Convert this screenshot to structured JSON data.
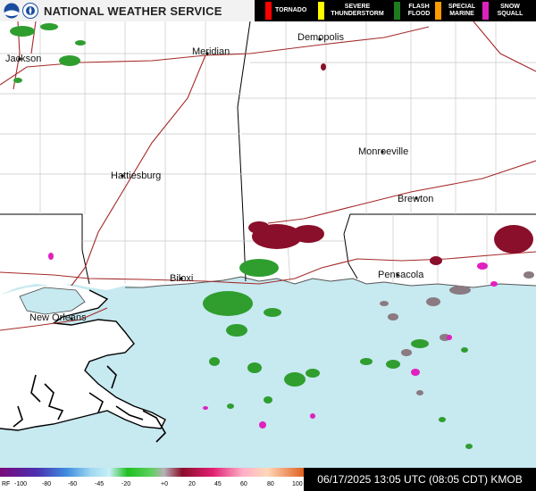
{
  "header": {
    "title": "NATIONAL WEATHER SERVICE",
    "legend": [
      {
        "label": "TORNADO",
        "color": "#ff0000"
      },
      {
        "label": "SEVERE THUNDERSTORM",
        "color": "#ffff00"
      },
      {
        "label": "FLASH FLOOD",
        "color": "#1e7a1e"
      },
      {
        "label": "SPECIAL MARINE",
        "color": "#ff9900"
      },
      {
        "label": "SNOW SQUALL",
        "color": "#dd22bb"
      }
    ]
  },
  "map": {
    "cities": [
      "Demopolis",
      "Jackson",
      "Meridian",
      "Monroeville",
      "Hattiesburg",
      "Brewton",
      "Biloxi",
      "Pensacola",
      "New Orleans"
    ],
    "water_color": "#c7e9f0",
    "land_color": "#ffffff"
  },
  "footer": {
    "scale_labels": [
      "RF",
      "-100",
      "-80",
      "-60",
      "-45",
      "-20",
      "+0",
      "20",
      "45",
      "60",
      "80",
      "100"
    ],
    "timestamp": "06/17/2025 13:05 UTC (08:05 CDT) KMOB"
  }
}
